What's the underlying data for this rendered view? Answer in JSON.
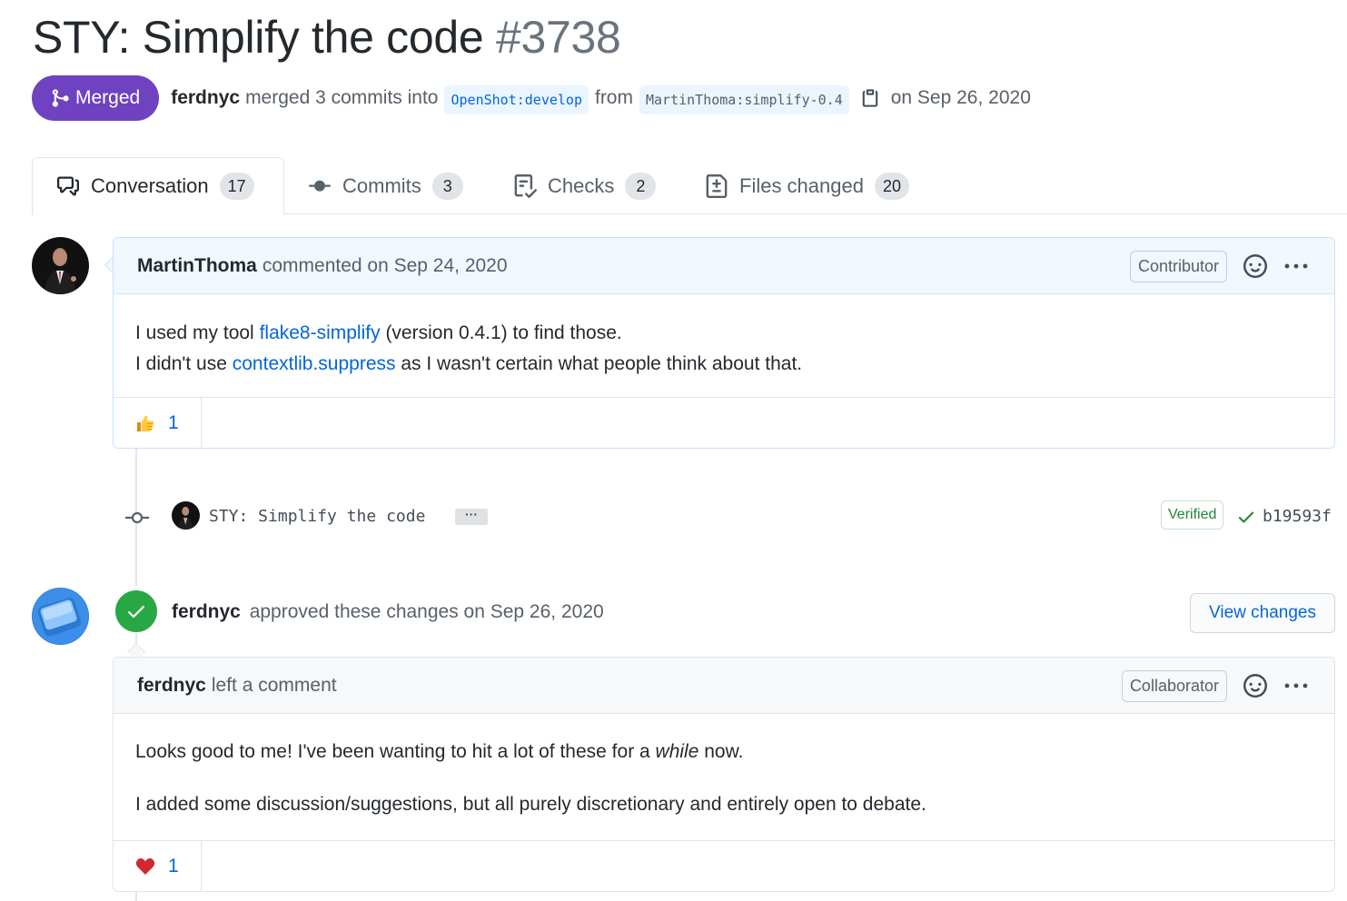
{
  "pr": {
    "title": "STY: Simplify the code",
    "number": "#3738",
    "state": "Merged",
    "author": "ferdnyc",
    "merge_text": "merged 3 commits into",
    "base_branch": "OpenShot:develop",
    "from_text": "from",
    "head_branch": "MartinThoma:simplify-0.4",
    "date_text": "on Sep 26, 2020"
  },
  "tabs": [
    {
      "label": "Conversation",
      "count": "17",
      "icon": "comment-discussion-icon"
    },
    {
      "label": "Commits",
      "count": "3",
      "icon": "git-commit-icon"
    },
    {
      "label": "Checks",
      "count": "2",
      "icon": "checklist-icon"
    },
    {
      "label": "Files changed",
      "count": "20",
      "icon": "file-diff-icon"
    }
  ],
  "comment1": {
    "author": "MartinThoma",
    "action": "commented on Sep 24, 2020",
    "role": "Contributor",
    "line1_pre": "I used my tool ",
    "line1_link": "flake8-simplify",
    "line1_post": " (version 0.4.1) to find those.",
    "line2_pre": "I didn't use ",
    "line2_link": "contextlib.suppress",
    "line2_post": " as I wasn't certain what people think about that.",
    "reaction_emoji": "thumbs-up-icon",
    "reaction_count": "1"
  },
  "commit": {
    "message": "STY: Simplify the code",
    "ellipsis": "···",
    "verified": "Verified",
    "sha": "b19593f"
  },
  "review": {
    "author": "ferdnyc",
    "action": "approved these changes on Sep 26, 2020",
    "view_changes": "View changes"
  },
  "comment2": {
    "author": "ferdnyc",
    "action": "left a comment",
    "role": "Collaborator",
    "para1_pre": "Looks good to me! I've been wanting to hit a lot of these for a ",
    "para1_em": "while",
    "para1_post": " now.",
    "para2": "I added some discussion/suggestions, but all purely discretionary and entirely open to debate.",
    "reaction_emoji": "heart-icon",
    "reaction_count": "1"
  },
  "colors": {
    "merged": "#6f42c1",
    "link": "#0366d6",
    "approved": "#28a745",
    "verified": "#22863a"
  }
}
